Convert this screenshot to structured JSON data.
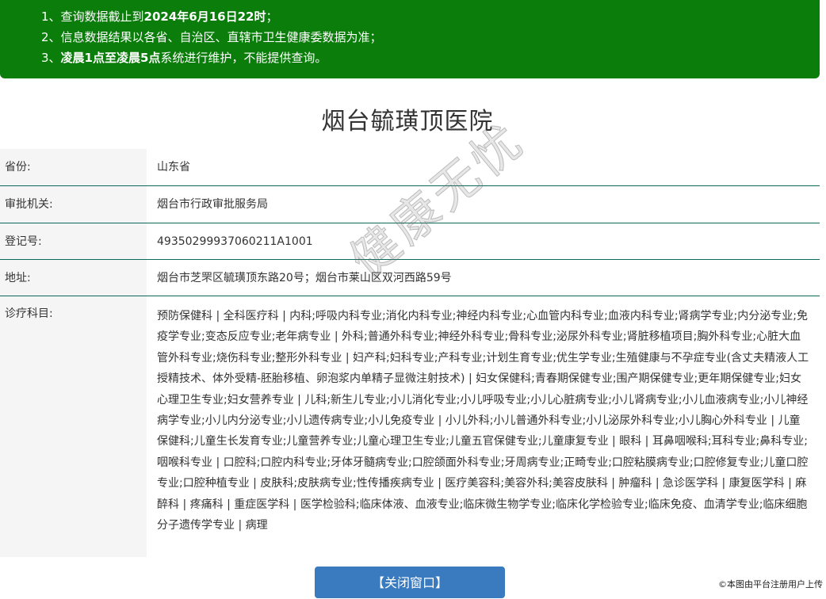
{
  "notice": {
    "line1_pre": "1、查询数据截止到",
    "line1_bold": "2024年6月16日22时",
    "line1_post": "；",
    "line2": "2、信息数据结果以各省、自治区、直辖市卫生健康委数据为准；",
    "line3_pre": "3、",
    "line3_bold": "凌晨1点至凌晨5点",
    "line3_post": "系统进行维护，不能提供查询。"
  },
  "title": "烟台毓璜顶医院",
  "fields": {
    "province": {
      "label": "省份:",
      "value": "山东省"
    },
    "authority": {
      "label": "审批机关:",
      "value": "烟台市行政审批服务局"
    },
    "regno": {
      "label": "登记号:",
      "value": "49350299937060211A1001"
    },
    "address": {
      "label": "地址:",
      "value": "烟台市芝罘区毓璜顶东路20号；烟台市莱山区双河西路59号"
    },
    "departments": {
      "label": "诊疗科目:",
      "value": "预防保健科 | 全科医疗科 | 内科;呼吸内科专业;消化内科专业;神经内科专业;心血管内科专业;血液内科专业;肾病学专业;内分泌专业;免疫学专业;变态反应专业;老年病专业 | 外科;普通外科专业;神经外科专业;骨科专业;泌尿外科专业;肾脏移植项目;胸外科专业;心脏大血管外科专业;烧伤科专业;整形外科专业 | 妇产科;妇科专业;产科专业;计划生育专业;优生学专业;生殖健康与不孕症专业(含丈夫精液人工授精技术、体外受精-胚胎移植、卵泡浆内单精子显微注射技术) | 妇女保健科;青春期保健专业;围产期保健专业;更年期保健专业;妇女心理卫生专业;妇女营养专业 | 儿科;新生儿专业;小儿消化专业;小儿呼吸专业;小儿心脏病专业;小儿肾病专业;小儿血液病专业;小儿神经病学专业;小儿内分泌专业;小儿遗传病专业;小儿免疫专业 | 小儿外科;小儿普通外科专业;小儿泌尿外科专业;小儿胸心外科专业 | 儿童保健科;儿童生长发育专业;儿童营养专业;儿童心理卫生专业;儿童五官保健专业;儿童康复专业 | 眼科 | 耳鼻咽喉科;耳科专业;鼻科专业;咽喉科专业 | 口腔科;口腔内科专业;牙体牙髓病专业;口腔颌面外科专业;牙周病专业;正畸专业;口腔粘膜病专业;口腔修复专业;儿童口腔专业;口腔种植专业 | 皮肤科;皮肤病专业;性传播疾病专业 | 医疗美容科;美容外科;美容皮肤科 | 肿瘤科 | 急诊医学科 | 康复医学科 | 麻醉科 | 疼痛科 | 重症医学科 | 医学检验科;临床体液、血液专业;临床微生物学专业;临床化学检验专业;临床免疫、血清学专业;临床细胞分子遗传学专业 | 病理"
    }
  },
  "watermark": "健康无忧",
  "close_button": "【关闭窗口】",
  "credit": "©本图由平台注册用户上传"
}
